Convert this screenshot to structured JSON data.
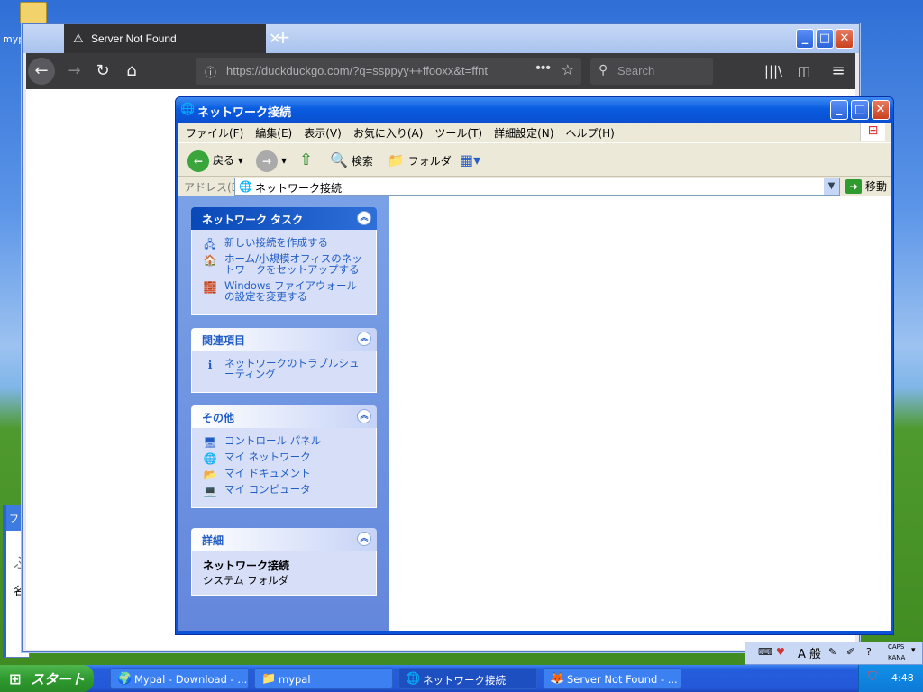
{
  "desktop": {
    "icon_label": "myp"
  },
  "background_window": {
    "title_fragment": "ファ",
    "content_1": "ぶ",
    "content_2": "名"
  },
  "firefox": {
    "tab_title": "Server Not Found",
    "url": "https://duckduckgo.com/?q=ssppyy++ffooxx&t=ffnt",
    "search_placeholder": "Search"
  },
  "explorer": {
    "title": "ネットワーク接続",
    "menu": [
      "ファイル(F)",
      "編集(E)",
      "表示(V)",
      "お気に入り(A)",
      "ツール(T)",
      "詳細設定(N)",
      "ヘルプ(H)"
    ],
    "toolbar": {
      "back": "戻る",
      "search": "検索",
      "folders": "フォルダ"
    },
    "address_label": "アドレス(D)",
    "address_value": "ネットワーク接続",
    "go_label": "移動",
    "panels": {
      "tasks": {
        "title": "ネットワーク タスク",
        "items": [
          "新しい接続を作成する",
          "ホーム/小規模オフィスのネットワークをセットアップする",
          "Windows ファイアウォールの設定を変更する"
        ]
      },
      "related": {
        "title": "関連項目",
        "items": [
          "ネットワークのトラブルシューティング"
        ]
      },
      "other": {
        "title": "その他",
        "items": [
          "コントロール パネル",
          "マイ ネットワーク",
          "マイ ドキュメント",
          "マイ コンピュータ"
        ]
      },
      "details": {
        "title": "詳細",
        "name": "ネットワーク接続",
        "type": "システム フォルダ"
      }
    }
  },
  "language_bar": {
    "ime_mode": "A 般",
    "caps": "CAPS",
    "kana": "KANA"
  },
  "taskbar": {
    "start_label": "スタート",
    "buttons": [
      "Mypal - Download - ...",
      "mypal",
      "ネットワーク接続",
      "Server Not Found - ..."
    ],
    "clock": "4:48"
  }
}
